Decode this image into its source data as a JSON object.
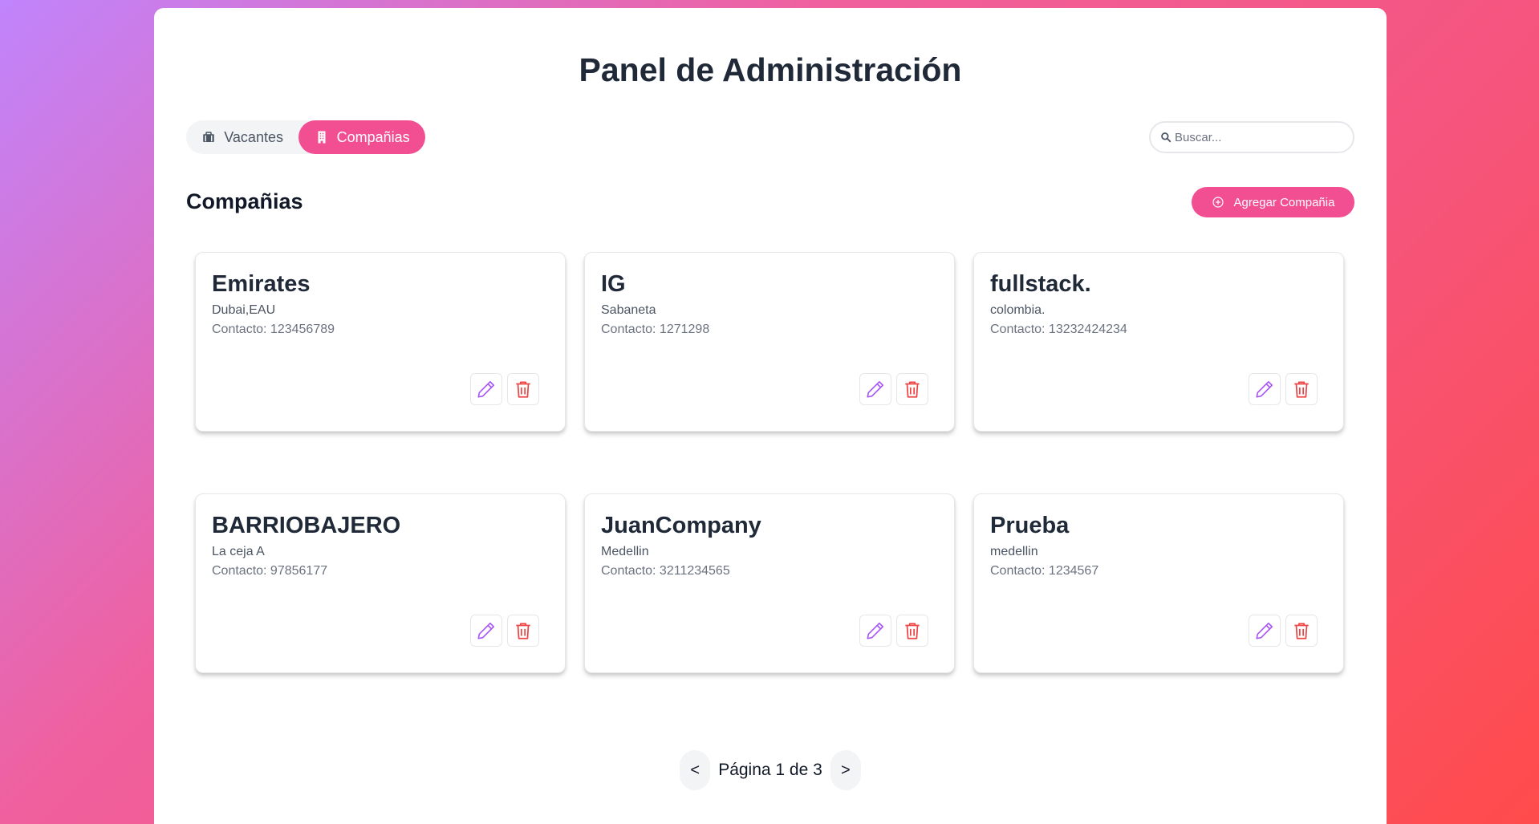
{
  "header": {
    "title": "Panel de Administración"
  },
  "tabs": [
    {
      "label": "Vacantes",
      "icon": "briefcase-icon",
      "active": false
    },
    {
      "label": "Compañias",
      "icon": "building-icon",
      "active": true
    }
  ],
  "search": {
    "placeholder": "Buscar...",
    "value": ""
  },
  "section": {
    "title": "Compañias",
    "add_label": "Agregar Compañia"
  },
  "companies": [
    {
      "name": "Emirates",
      "location": "Dubai,EAU",
      "contact": "Contacto: 123456789"
    },
    {
      "name": "IG",
      "location": "Sabaneta",
      "contact": "Contacto: 1271298"
    },
    {
      "name": "fullstack.",
      "location": "colombia.",
      "contact": "Contacto: 13232424234"
    },
    {
      "name": "BARRIOBAJERO",
      "location": "La ceja A",
      "contact": "Contacto: 97856177"
    },
    {
      "name": "JuanCompany",
      "location": "Medellin",
      "contact": "Contacto: 3211234565"
    },
    {
      "name": "Prueba",
      "location": "medellin",
      "contact": "Contacto: 1234567"
    }
  ],
  "pagination": {
    "prev": "<",
    "label": "Página 1 de 3",
    "next": ">"
  },
  "colors": {
    "accent": "#f24f93",
    "edit": "#a855f7",
    "delete": "#ef4444"
  }
}
